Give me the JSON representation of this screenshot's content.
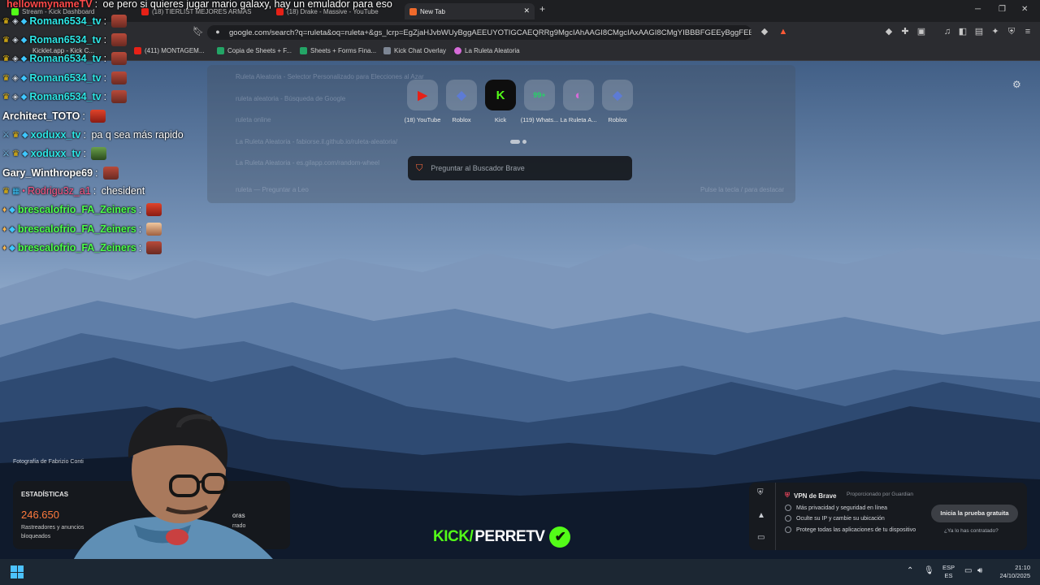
{
  "browser": {
    "tabs": [
      {
        "label": "Stream - Kick Dashboard",
        "color": "#53fc18"
      },
      {
        "label": "(18) TIERLIST MEJORES ARMAS",
        "color": "#e62117"
      },
      {
        "label": "(18) Drake - Massive - YouTube",
        "color": "#e62117"
      },
      {
        "label": "New Tab",
        "color": "#f06a2b"
      }
    ],
    "new_tab_glyph": "+",
    "second_row_tabs": [
      {
        "label": "Kicklet.app - Kick C..."
      },
      {
        "label": "(411) MONTAGEM..."
      }
    ],
    "url": "google.com/search?q=ruleta&oq=ruleta+&gs_lcrp=EgZjaHJvbWUyBggAEEUYOTIGCAEQRRg9MgcIAhAAGI8CMgcIAxAAGI8CMgYIBBBFGEEyBggFEEUYPTI...",
    "bookmarks": [
      {
        "label": "Copia de Sheets + F..."
      },
      {
        "label": "Sheets + Forms Fina..."
      },
      {
        "label": "Kick Chat Overlay"
      },
      {
        "label": "La Ruleta Aleatoria"
      }
    ]
  },
  "dropdown": {
    "rows": [
      "Ruleta Aleatoria - Selector Personalizado para Elecciones al Azar",
      "ruleta aleatoria - Búsqueda de Google",
      "ruleta online",
      "La Ruleta Aleatoria - fabiorse.il.github.io/ruleta-aleatoria/",
      "La Ruleta Aleatoria - es.gilapp.com/random-wheel",
      "ruleta — Preguntar a Leo"
    ],
    "hint": "Pulse la tecla / para destacar"
  },
  "speed_dial": [
    {
      "label": "(18) YouTube",
      "icon": "youtube-icon",
      "glyph": "▶",
      "color": "#e62117"
    },
    {
      "label": "Roblox",
      "icon": "roblox-icon",
      "glyph": "◆",
      "color": "#5d7bd5"
    },
    {
      "label": "Kick",
      "icon": "kick-icon",
      "glyph": "K",
      "color": "#53fc18"
    },
    {
      "label": "(119) Whats...",
      "icon": "whatsapp-icon",
      "glyph": "99+",
      "color": "#25d366"
    },
    {
      "label": "La Ruleta A...",
      "icon": "ruleta-icon",
      "glyph": "◐",
      "color": "#d66bd8"
    },
    {
      "label": "Roblox",
      "icon": "roblox-icon",
      "glyph": "◆",
      "color": "#5d7bd5"
    }
  ],
  "brave_search": {
    "placeholder": "Preguntar al Buscador Brave"
  },
  "chat": [
    {
      "user": "hellowmynameTV",
      "color": "#ff4a4a",
      "message": "oe pero si quieres jugar mario galaxy, hay un emulador para eso",
      "emote": false
    },
    {
      "user": "Roman6534_tv",
      "color": "#2ee6e6",
      "message": "",
      "emote": true
    },
    {
      "user": "Roman6534_tv",
      "color": "#2ee6e6",
      "message": "",
      "emote": true
    },
    {
      "user": "Roman6534_tv",
      "color": "#2ee6e6",
      "message": "",
      "emote": true
    },
    {
      "user": "Roman6534_tv",
      "color": "#2ee6e6",
      "message": "",
      "emote": true
    },
    {
      "user": "Roman6534_tv",
      "color": "#2ee6e6",
      "message": "",
      "emote": true
    },
    {
      "user": "Architect_TOTO",
      "color": "#ffffff",
      "message": "",
      "emote": true
    },
    {
      "user": "xoduxx_tv",
      "color": "#2ee6e6",
      "message": "pa q sea más rapido",
      "emote": false
    },
    {
      "user": "xoduxx_tv",
      "color": "#2ee6e6",
      "message": "",
      "emote": true
    },
    {
      "user": "Gary_Winthrope69",
      "color": "#ffffff",
      "message": "",
      "emote": true
    },
    {
      "user": "Rodrigu3z_a1",
      "color": "#ff5a8a",
      "message": "chesident",
      "emote": false
    },
    {
      "user": "brescalofrio_FA_Zeiners",
      "color": "#4cff4c",
      "message": "",
      "emote": true
    },
    {
      "user": "brescalofrio_FA_Zeiners",
      "color": "#4cff4c",
      "message": "",
      "emote": true
    },
    {
      "user": "brescalofrio_FA_Zeiners",
      "color": "#4cff4c",
      "message": "",
      "emote": true
    }
  ],
  "photo_credit": "Fotografía de Fabrizio Conti",
  "stats": {
    "heading": "ESTADÍSTICAS",
    "trackers_count": "246.650",
    "trackers_label": "Rastreadores y anuncios bloqueados",
    "right_label": "oras",
    "right_sub": "rrado"
  },
  "kick_brand": {
    "kick": "KICK/",
    "name": "PERRETV",
    "check": "✔"
  },
  "vpn": {
    "title": "VPN de Brave",
    "provider": "Proporcionado por Guardian",
    "features": [
      "Más privacidad y seguridad en línea",
      "Oculte su IP y cambie su ubicación",
      "Protege todas las aplicaciones de tu dispositivo"
    ],
    "cta": "Inicia la prueba gratuita",
    "already": "¿Ya lo has contratado?"
  },
  "taskbar": {
    "lang_top": "ESP",
    "lang_bottom": "ES",
    "time": "21:10",
    "date": "24/10/2025"
  }
}
